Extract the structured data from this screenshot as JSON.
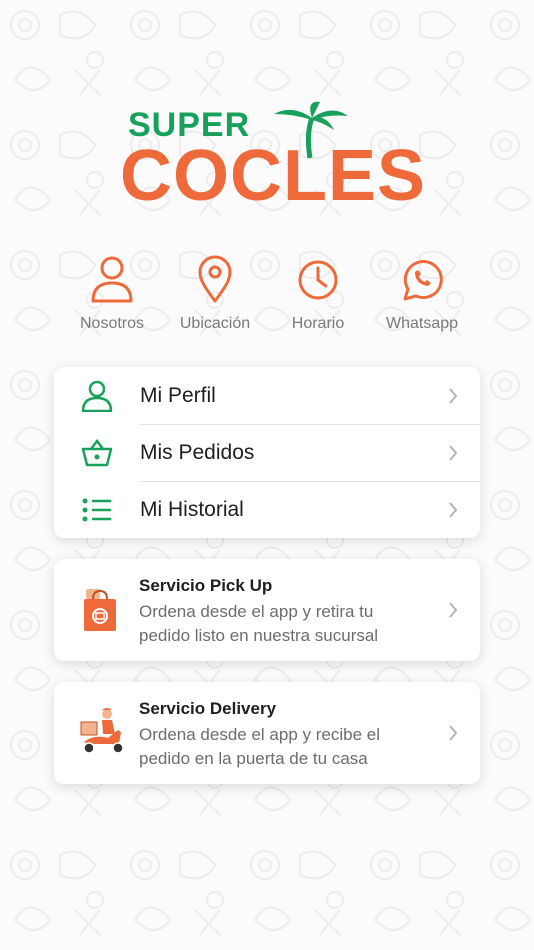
{
  "brand": {
    "logo_top": "SUPER",
    "logo_main": "COCLES"
  },
  "quick_links": [
    {
      "label": "Nosotros",
      "icon": "user-icon"
    },
    {
      "label": "Ubicación",
      "icon": "location-pin-icon"
    },
    {
      "label": "Horario",
      "icon": "clock-icon"
    },
    {
      "label": "Whatsapp",
      "icon": "whatsapp-icon"
    }
  ],
  "menu": [
    {
      "label": "Mi Perfil",
      "icon": "user-icon"
    },
    {
      "label": "Mis Pedidos",
      "icon": "basket-icon"
    },
    {
      "label": "Mi Historial",
      "icon": "list-icon"
    }
  ],
  "services": [
    {
      "title": "Servicio Pick Up",
      "description": "Ordena desde el app y retira tu pedido listo en nuestra sucursal",
      "icon": "shopping-bag-icon"
    },
    {
      "title": "Servicio Delivery",
      "description": "Ordena desde el app y recibe el pedido en la puerta de tu casa",
      "icon": "delivery-scooter-icon"
    }
  ],
  "colors": {
    "accent_orange": "#ef6a3a",
    "accent_green": "#18a15a",
    "text_dark": "#1f1f1f",
    "text_muted": "#7a7a7a"
  }
}
